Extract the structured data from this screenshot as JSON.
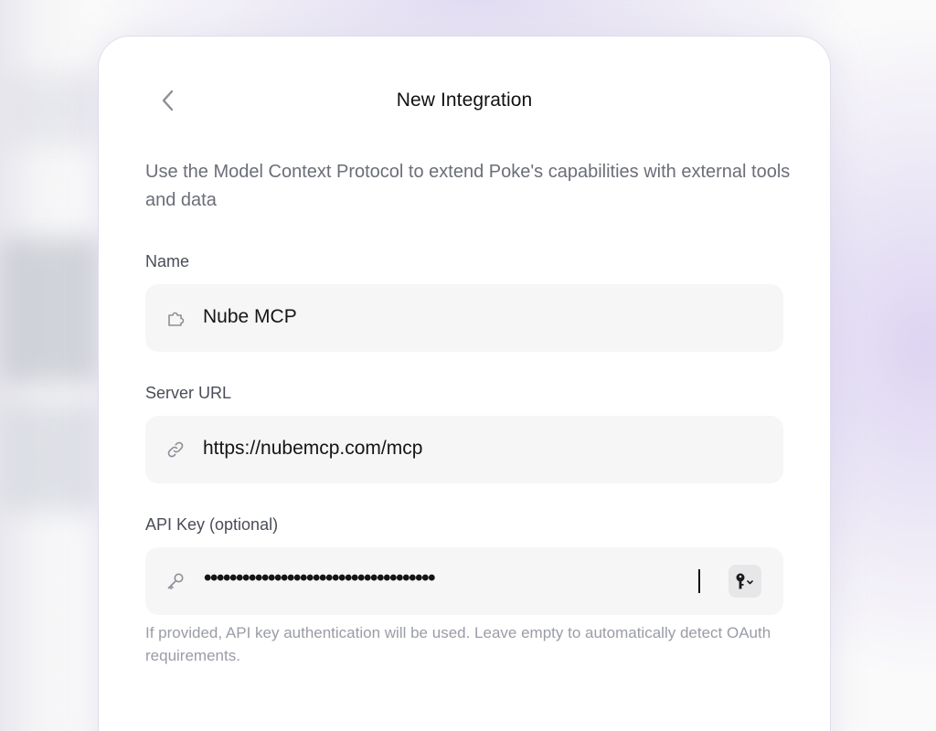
{
  "header": {
    "title": "New Integration"
  },
  "intro": {
    "text": "Use the Model Context Protocol to extend Poke's capabilities with external tools and data"
  },
  "form": {
    "name": {
      "label": "Name",
      "value": "Nube MCP",
      "icon": "puzzle-icon"
    },
    "server_url": {
      "label": "Server URL",
      "value": "https://nubemcp.com/mcp",
      "icon": "link-icon"
    },
    "api_key": {
      "label": "API Key (optional)",
      "masked_value": "••••••••••••••••••••••••••••••••••••",
      "icon": "key-icon",
      "password_manager_icon": "password-key-icon"
    },
    "hint": "If provided, API key authentication will be used. Leave empty to automatically detect OAuth requirements."
  }
}
